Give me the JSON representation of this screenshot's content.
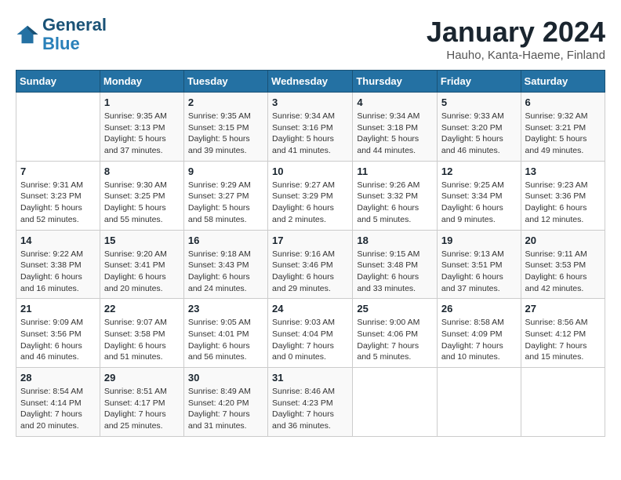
{
  "logo": {
    "line1": "General",
    "line2": "Blue"
  },
  "title": "January 2024",
  "subtitle": "Hauho, Kanta-Haeme, Finland",
  "days_header": [
    "Sunday",
    "Monday",
    "Tuesday",
    "Wednesday",
    "Thursday",
    "Friday",
    "Saturday"
  ],
  "weeks": [
    [
      {
        "num": "",
        "info": ""
      },
      {
        "num": "1",
        "info": "Sunrise: 9:35 AM\nSunset: 3:13 PM\nDaylight: 5 hours\nand 37 minutes."
      },
      {
        "num": "2",
        "info": "Sunrise: 9:35 AM\nSunset: 3:15 PM\nDaylight: 5 hours\nand 39 minutes."
      },
      {
        "num": "3",
        "info": "Sunrise: 9:34 AM\nSunset: 3:16 PM\nDaylight: 5 hours\nand 41 minutes."
      },
      {
        "num": "4",
        "info": "Sunrise: 9:34 AM\nSunset: 3:18 PM\nDaylight: 5 hours\nand 44 minutes."
      },
      {
        "num": "5",
        "info": "Sunrise: 9:33 AM\nSunset: 3:20 PM\nDaylight: 5 hours\nand 46 minutes."
      },
      {
        "num": "6",
        "info": "Sunrise: 9:32 AM\nSunset: 3:21 PM\nDaylight: 5 hours\nand 49 minutes."
      }
    ],
    [
      {
        "num": "7",
        "info": "Sunrise: 9:31 AM\nSunset: 3:23 PM\nDaylight: 5 hours\nand 52 minutes."
      },
      {
        "num": "8",
        "info": "Sunrise: 9:30 AM\nSunset: 3:25 PM\nDaylight: 5 hours\nand 55 minutes."
      },
      {
        "num": "9",
        "info": "Sunrise: 9:29 AM\nSunset: 3:27 PM\nDaylight: 5 hours\nand 58 minutes."
      },
      {
        "num": "10",
        "info": "Sunrise: 9:27 AM\nSunset: 3:29 PM\nDaylight: 6 hours\nand 2 minutes."
      },
      {
        "num": "11",
        "info": "Sunrise: 9:26 AM\nSunset: 3:32 PM\nDaylight: 6 hours\nand 5 minutes."
      },
      {
        "num": "12",
        "info": "Sunrise: 9:25 AM\nSunset: 3:34 PM\nDaylight: 6 hours\nand 9 minutes."
      },
      {
        "num": "13",
        "info": "Sunrise: 9:23 AM\nSunset: 3:36 PM\nDaylight: 6 hours\nand 12 minutes."
      }
    ],
    [
      {
        "num": "14",
        "info": "Sunrise: 9:22 AM\nSunset: 3:38 PM\nDaylight: 6 hours\nand 16 minutes."
      },
      {
        "num": "15",
        "info": "Sunrise: 9:20 AM\nSunset: 3:41 PM\nDaylight: 6 hours\nand 20 minutes."
      },
      {
        "num": "16",
        "info": "Sunrise: 9:18 AM\nSunset: 3:43 PM\nDaylight: 6 hours\nand 24 minutes."
      },
      {
        "num": "17",
        "info": "Sunrise: 9:16 AM\nSunset: 3:46 PM\nDaylight: 6 hours\nand 29 minutes."
      },
      {
        "num": "18",
        "info": "Sunrise: 9:15 AM\nSunset: 3:48 PM\nDaylight: 6 hours\nand 33 minutes."
      },
      {
        "num": "19",
        "info": "Sunrise: 9:13 AM\nSunset: 3:51 PM\nDaylight: 6 hours\nand 37 minutes."
      },
      {
        "num": "20",
        "info": "Sunrise: 9:11 AM\nSunset: 3:53 PM\nDaylight: 6 hours\nand 42 minutes."
      }
    ],
    [
      {
        "num": "21",
        "info": "Sunrise: 9:09 AM\nSunset: 3:56 PM\nDaylight: 6 hours\nand 46 minutes."
      },
      {
        "num": "22",
        "info": "Sunrise: 9:07 AM\nSunset: 3:58 PM\nDaylight: 6 hours\nand 51 minutes."
      },
      {
        "num": "23",
        "info": "Sunrise: 9:05 AM\nSunset: 4:01 PM\nDaylight: 6 hours\nand 56 minutes."
      },
      {
        "num": "24",
        "info": "Sunrise: 9:03 AM\nSunset: 4:04 PM\nDaylight: 7 hours\nand 0 minutes."
      },
      {
        "num": "25",
        "info": "Sunrise: 9:00 AM\nSunset: 4:06 PM\nDaylight: 7 hours\nand 5 minutes."
      },
      {
        "num": "26",
        "info": "Sunrise: 8:58 AM\nSunset: 4:09 PM\nDaylight: 7 hours\nand 10 minutes."
      },
      {
        "num": "27",
        "info": "Sunrise: 8:56 AM\nSunset: 4:12 PM\nDaylight: 7 hours\nand 15 minutes."
      }
    ],
    [
      {
        "num": "28",
        "info": "Sunrise: 8:54 AM\nSunset: 4:14 PM\nDaylight: 7 hours\nand 20 minutes."
      },
      {
        "num": "29",
        "info": "Sunrise: 8:51 AM\nSunset: 4:17 PM\nDaylight: 7 hours\nand 25 minutes."
      },
      {
        "num": "30",
        "info": "Sunrise: 8:49 AM\nSunset: 4:20 PM\nDaylight: 7 hours\nand 31 minutes."
      },
      {
        "num": "31",
        "info": "Sunrise: 8:46 AM\nSunset: 4:23 PM\nDaylight: 7 hours\nand 36 minutes."
      },
      {
        "num": "",
        "info": ""
      },
      {
        "num": "",
        "info": ""
      },
      {
        "num": "",
        "info": ""
      }
    ]
  ]
}
